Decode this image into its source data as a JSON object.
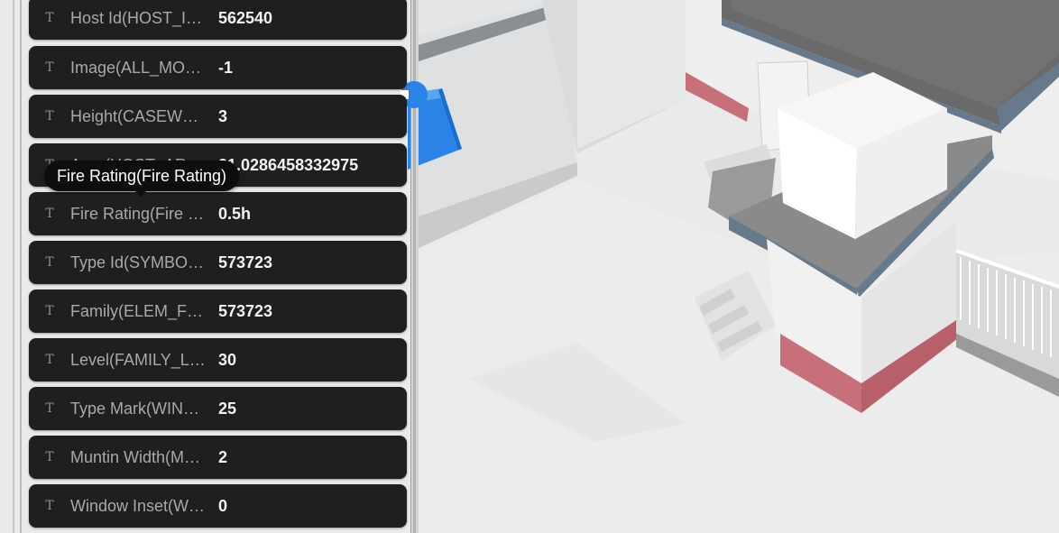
{
  "properties": [
    {
      "name": "Host Id(HOST_I…",
      "value": "562540"
    },
    {
      "name": "Image(ALL_MO…",
      "value": "-1"
    },
    {
      "name": "Height(CASEW…",
      "value": "3"
    },
    {
      "name": "Area(HOST_AR…",
      "value": "21.0286458332975"
    },
    {
      "name": "Fire Rating(Fire …",
      "value": "0.5h"
    },
    {
      "name": "Type Id(SYMBO…",
      "value": "573723"
    },
    {
      "name": "Family(ELEM_F…",
      "value": "573723"
    },
    {
      "name": "Level(FAMILY_L…",
      "value": "30"
    },
    {
      "name": "Type Mark(WIN…",
      "value": "25"
    },
    {
      "name": "Muntin Width(M…",
      "value": "2"
    },
    {
      "name": "Window Inset(W…",
      "value": "0"
    }
  ],
  "tooltip": {
    "text": "Fire Rating(Fire Rating)"
  },
  "icons": {
    "property_type": "text-type-icon",
    "glyph": "T"
  },
  "colors": {
    "row_bg": "#1f1f1f",
    "name_text": "#a9a9a9",
    "value_text": "#f3f3f3",
    "tooltip_bg": "#0e0e0e",
    "selection_blue": "#2a84e8",
    "wall_red": "#c8707a",
    "roof_slate": "#667a8c"
  }
}
